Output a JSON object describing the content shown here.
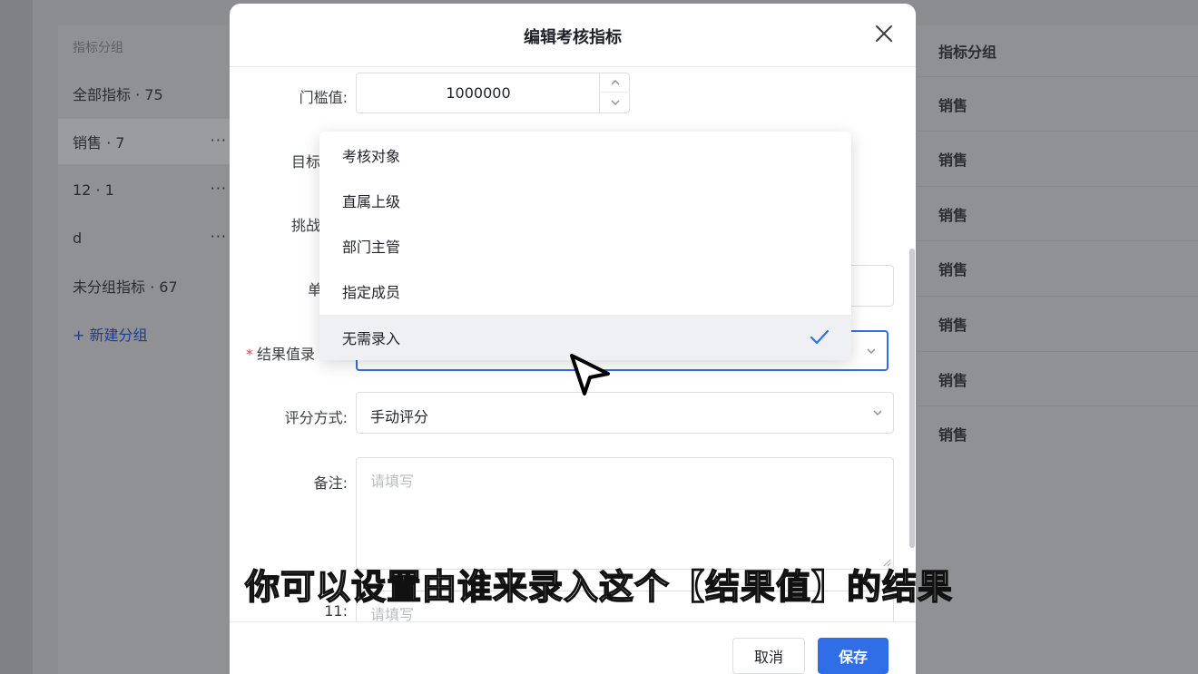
{
  "left_panel": {
    "header": "指标分组",
    "items": [
      {
        "label": "全部指标 · 75",
        "more": ""
      },
      {
        "label": "销售 · 7",
        "more": "···"
      },
      {
        "label": "12 · 1",
        "more": "···"
      },
      {
        "label": "d",
        "more": "···"
      },
      {
        "label": "未分组指标 · 67",
        "more": ""
      }
    ],
    "new_group": "+ 新建分组"
  },
  "right_panel": {
    "header": "指标分组",
    "rows": [
      "销售",
      "销售",
      "销售",
      "销售",
      "销售",
      "销售",
      "销售"
    ]
  },
  "modal": {
    "title": "编辑考核指标",
    "threshold_label": "门槛值:",
    "threshold_value": "1000000",
    "target_label": "目标",
    "challenge_label": "挑战",
    "unit_label": "单",
    "result_label": "结果值录",
    "scoring_label": "评分方式:",
    "scoring_value": "手动评分",
    "remark_label": "备注:",
    "remark_placeholder": "请填写",
    "field11_label": "11:",
    "field11_placeholder": "请填写",
    "cancel": "取消",
    "save": "保存"
  },
  "dropdown": {
    "options": [
      {
        "label": "考核对象",
        "selected": false
      },
      {
        "label": "直属上级",
        "selected": false
      },
      {
        "label": "部门主管",
        "selected": false
      },
      {
        "label": "指定成员",
        "selected": false
      },
      {
        "label": "无需录入",
        "selected": true
      }
    ]
  },
  "subtitle": "你可以设置由谁来录入这个【结果值】的结果",
  "colors": {
    "accent": "#2f6ee6",
    "required": "#e5484d"
  }
}
